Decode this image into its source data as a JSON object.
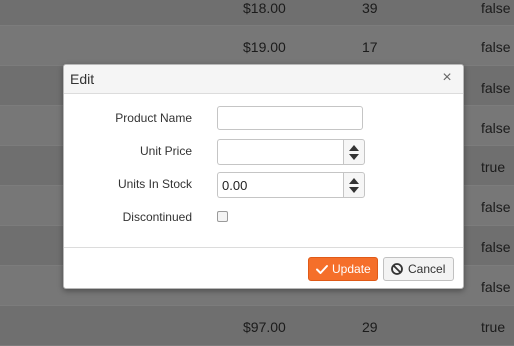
{
  "table": {
    "rows": [
      {
        "price": "$18.00",
        "stock": "39",
        "discontinued": "false"
      },
      {
        "price": "$19.00",
        "stock": "17",
        "discontinued": "false"
      },
      {
        "price": "",
        "stock": "",
        "discontinued": "false"
      },
      {
        "price": "",
        "stock": "",
        "discontinued": "false"
      },
      {
        "price": "",
        "stock": "",
        "discontinued": "true"
      },
      {
        "price": "",
        "stock": "",
        "discontinued": "false"
      },
      {
        "price": "",
        "stock": "",
        "discontinued": "false"
      },
      {
        "price": "",
        "stock": "",
        "discontinued": "false"
      },
      {
        "price": "$97.00",
        "stock": "29",
        "discontinued": "true"
      }
    ]
  },
  "dialog": {
    "title": "Edit",
    "close_glyph": "×",
    "fields": {
      "product_name": {
        "label": "Product Name",
        "value": ""
      },
      "unit_price": {
        "label": "Unit Price",
        "value": ""
      },
      "units_in_stock": {
        "label": "Units In Stock",
        "value": "0.00"
      },
      "discontinued": {
        "label": "Discontinued",
        "checked": false
      }
    },
    "buttons": {
      "update": {
        "label": "Update",
        "icon": "check-icon"
      },
      "cancel": {
        "label": "Cancel",
        "icon": "cancel-icon"
      }
    }
  },
  "colors": {
    "accent": "#f56f2a",
    "overlay_bg": "#6e6e6e"
  }
}
